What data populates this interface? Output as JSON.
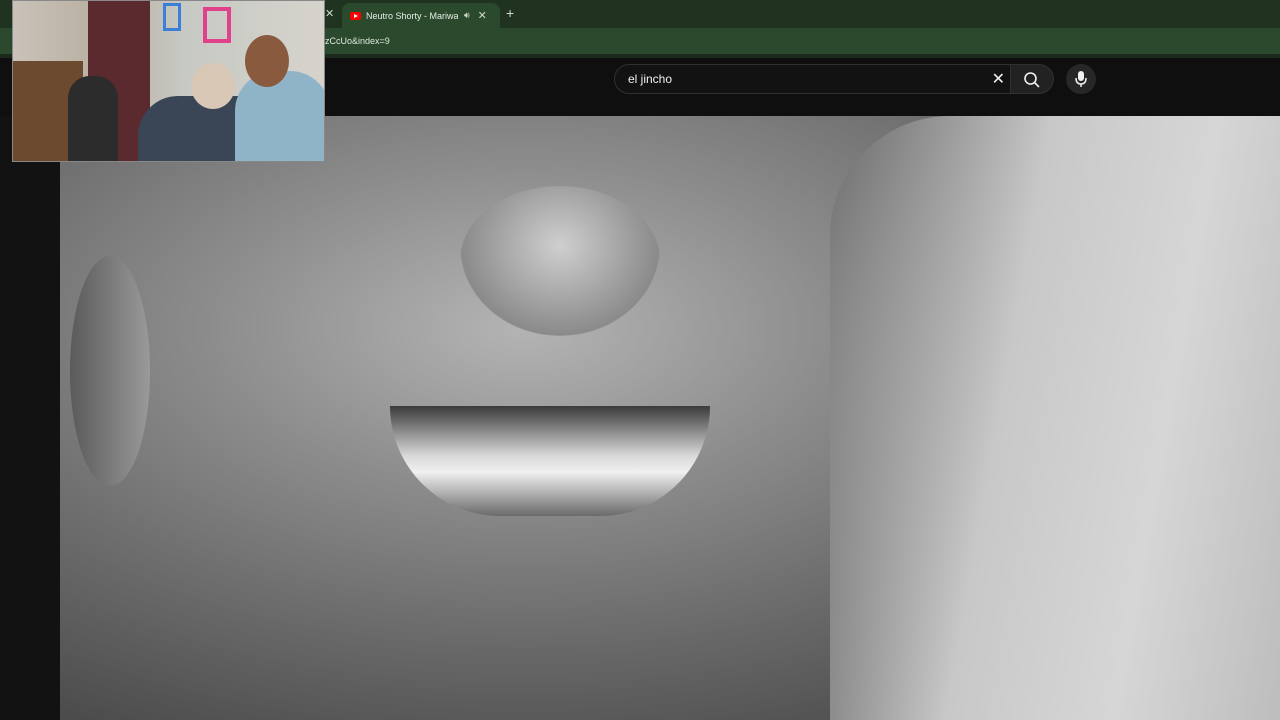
{
  "browser": {
    "tab": {
      "title": "Neutro Shorty - Mariwana",
      "audio_icon": "speaker-icon",
      "favicon": "youtube-icon"
    },
    "url": "zCcUo&index=9",
    "accent": "#2b4a2d"
  },
  "youtube": {
    "search_value": "el jincho",
    "icons": [
      "close-icon",
      "search-icon",
      "mic-icon"
    ]
  }
}
